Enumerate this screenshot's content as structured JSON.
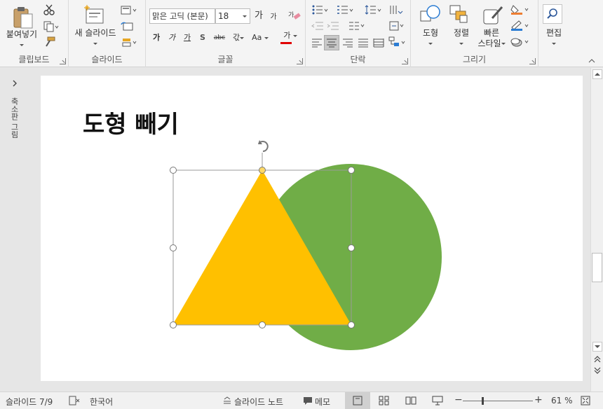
{
  "clipboard": {
    "paste_label": "붙여넣기",
    "group_label": "클립보드"
  },
  "slides_group": {
    "new_slide_label": "새 슬라이드",
    "group_label": "슬라이드"
  },
  "font_group": {
    "font_name": "맑은 고딕 (본문)",
    "font_size": "18",
    "group_label": "글꼴",
    "bold": "가",
    "italic": "가",
    "underline": "가",
    "shadow": "S",
    "strike": "abc",
    "spacing": "갃​",
    "case": "Aa",
    "font_color": "가",
    "grow": "가",
    "shrink": "가",
    "clear": "가"
  },
  "paragraph": {
    "group_label": "단락"
  },
  "drawing": {
    "shape_label": "도형",
    "arrange_label": "정렬",
    "quick_styles_label_1": "빠른",
    "quick_styles_label_2": "스타일",
    "group_label": "그리기"
  },
  "editing": {
    "label": "편집"
  },
  "left_panel": {
    "label": "축소판 그림"
  },
  "slide": {
    "title": "도형 빼기",
    "triangle_color": "#ffc000",
    "circle_color": "#70ad47"
  },
  "status": {
    "slide_info": "슬라이드 7/9",
    "language": "한국어",
    "notes": "슬라이드 노트",
    "comments": "메모",
    "zoom": "61 %"
  }
}
